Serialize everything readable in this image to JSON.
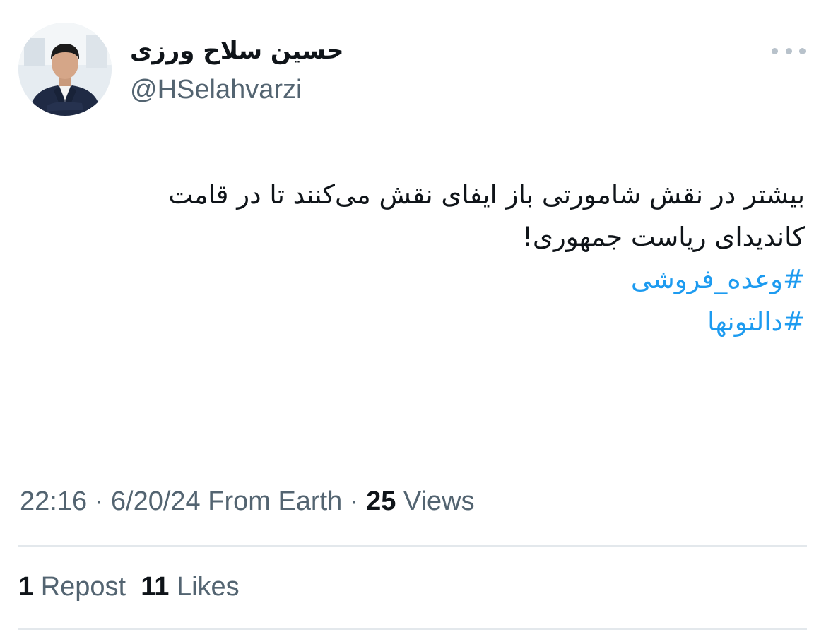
{
  "author": {
    "display_name": "حسین سلاح ورزی",
    "handle": "@HSelahvarzi"
  },
  "tweet": {
    "lines": [
      "بیشتر در نقش شامورتی باز ایفای نقش می‌کنند تا در قامت",
      "کاندیدای ریاست جمهوری!"
    ],
    "hashtags": [
      "#وعده_فروشی",
      "#دالتونها"
    ]
  },
  "meta": {
    "time": "22:16",
    "date": "6/20/24",
    "source": "From Earth",
    "separator": "·",
    "views_count": "25",
    "views_label": "Views"
  },
  "stats": {
    "reposts_count": "1",
    "reposts_label": "Repost",
    "likes_count": "11",
    "likes_label": "Likes"
  },
  "icons": {
    "more": "more-horizontal-icon"
  },
  "colors": {
    "text": "#0f1419",
    "secondary": "#536471",
    "link": "#1d9bf0",
    "divider": "#e3e8ec"
  }
}
